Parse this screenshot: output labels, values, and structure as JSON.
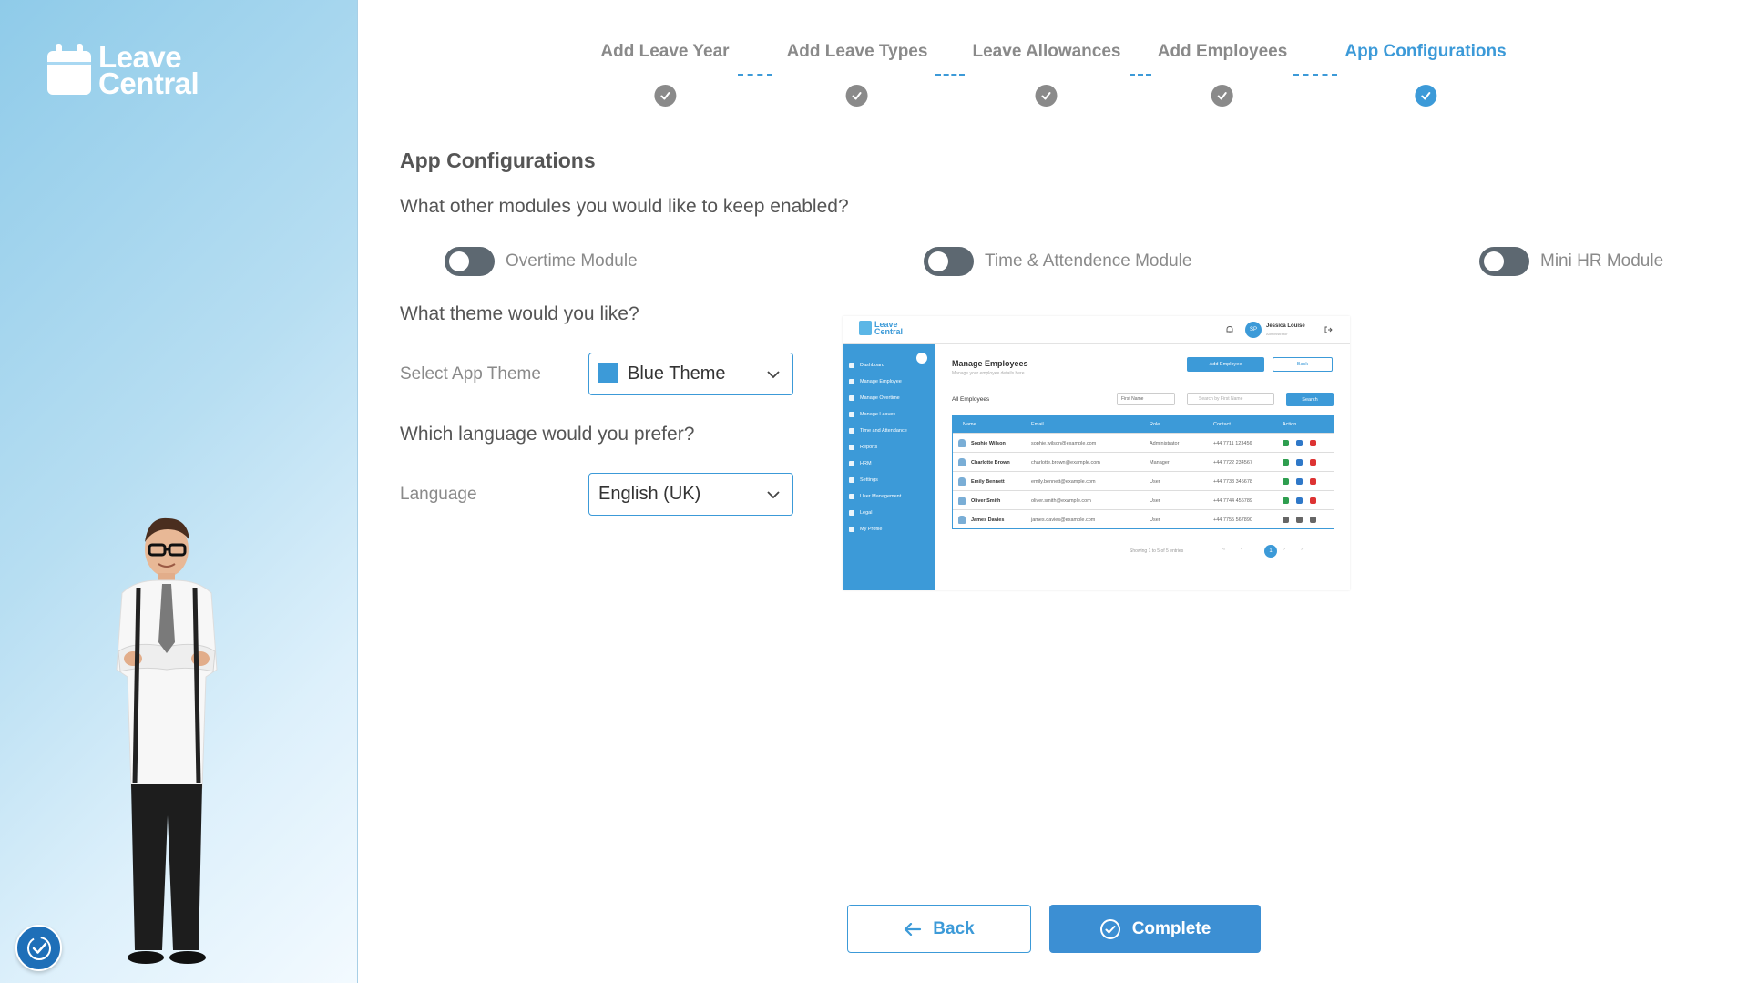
{
  "brand": {
    "line1": "Leave",
    "line2": "Central"
  },
  "stepper": {
    "steps": [
      {
        "label": "Add Leave Year",
        "state": "done"
      },
      {
        "label": "Add Leave Types",
        "state": "done"
      },
      {
        "label": "Leave Allowances",
        "state": "done"
      },
      {
        "label": "Add Employees",
        "state": "done"
      },
      {
        "label": "App Configurations",
        "state": "active"
      }
    ]
  },
  "content": {
    "title": "App Configurations",
    "modules_question": "What other modules you would like to keep enabled?",
    "modules": [
      {
        "label": "Overtime Module",
        "enabled": false
      },
      {
        "label": "Time & Attendence Module",
        "enabled": false
      },
      {
        "label": "Mini HR Module",
        "enabled": false
      }
    ],
    "theme_question": "What theme would you like?",
    "theme_label": "Select App Theme",
    "theme_value": "Blue Theme",
    "theme_color": "#3c9ad8",
    "language_question": "Which language would you prefer?",
    "language_label": "Language",
    "language_value": "English (UK)"
  },
  "preview": {
    "logo_line1": "Leave",
    "logo_line2": "Central",
    "avatar_initials": "SP",
    "user_name": "Jessica Louise",
    "user_role": "Administrator",
    "nav": [
      "Dashboard",
      "Manage Employee",
      "Manage Overtime",
      "Manage Leaves",
      "Time and Attendance",
      "Reports",
      "HRM",
      "Settings",
      "User Management",
      "Legal",
      "My Profile"
    ],
    "page_title": "Manage Employees",
    "page_subtitle": "Manage your employee details here",
    "add_button": "Add Employee",
    "back_button": "Back",
    "list_title": "All Employees",
    "filter_value": "First Name",
    "search_placeholder": "Search by First Name",
    "search_button": "Search",
    "columns": [
      "Name",
      "Email",
      "Role",
      "Contact",
      "Action"
    ],
    "rows": [
      {
        "name": "Sophie Wilson",
        "email": "sophie.wilson@example.com",
        "role": "Administrator",
        "contact": "+44 7711 123456"
      },
      {
        "name": "Charlotte Brown",
        "email": "charlotte.brown@example.com",
        "role": "Manager",
        "contact": "+44 7722 234567"
      },
      {
        "name": "Emily Bennett",
        "email": "emily.bennett@example.com",
        "role": "User",
        "contact": "+44 7733 345678"
      },
      {
        "name": "Oliver Smith",
        "email": "oliver.smith@example.com",
        "role": "User",
        "contact": "+44 7744 456789"
      },
      {
        "name": "James Davies",
        "email": "james.davies@example.com",
        "role": "User",
        "contact": "+44 7755 567890"
      }
    ],
    "footer": "Showing 1 to 5 of 5 entries",
    "current_page": "1"
  },
  "actions": {
    "back": "Back",
    "complete": "Complete"
  },
  "colors": {
    "accent": "#3c9ad8",
    "inactive": "#8a8a8a",
    "toggle_off": "#5d6871"
  }
}
